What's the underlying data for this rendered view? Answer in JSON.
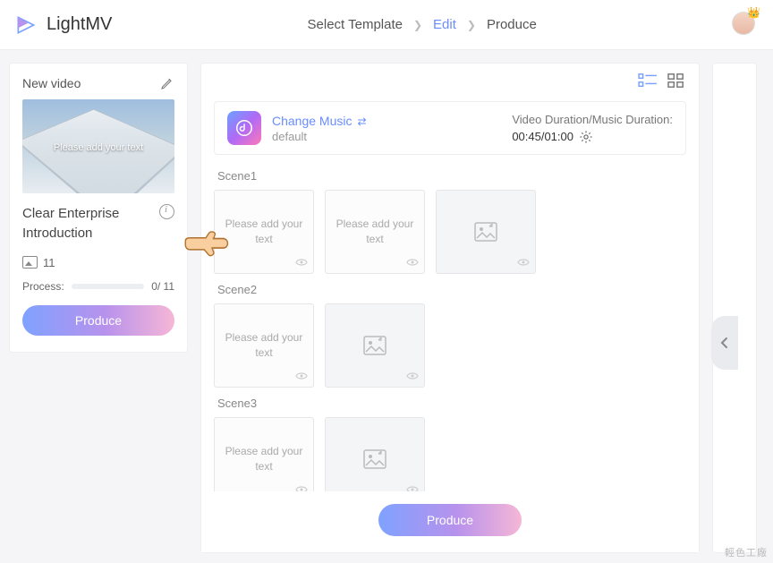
{
  "brand": "LightMV",
  "breadcrumb": {
    "step1": "Select Template",
    "step2": "Edit",
    "step3": "Produce"
  },
  "sidebar": {
    "title": "New video",
    "thumb_overlay": "Please add your text",
    "template_name": "Clear Enterprise Introduction",
    "image_count": "11",
    "process_label": "Process:",
    "process_value": "0/ 11",
    "produce_label": "Produce"
  },
  "music": {
    "change_label": "Change Music",
    "default_label": "default",
    "duration_label": "Video Duration/Music Duration:",
    "duration_value": "00:45/01:00"
  },
  "scenes": [
    {
      "name": "Scene1",
      "tiles": [
        {
          "type": "text",
          "placeholder": "Please add your text"
        },
        {
          "type": "text",
          "placeholder": "Please add your text"
        },
        {
          "type": "image"
        }
      ]
    },
    {
      "name": "Scene2",
      "tiles": [
        {
          "type": "text",
          "placeholder": "Please add your text"
        },
        {
          "type": "image"
        }
      ]
    },
    {
      "name": "Scene3",
      "tiles": [
        {
          "type": "text",
          "placeholder": "Please add your text"
        },
        {
          "type": "image"
        }
      ]
    }
  ],
  "footer": {
    "produce_label": "Produce"
  },
  "watermark": "輕色工廠"
}
